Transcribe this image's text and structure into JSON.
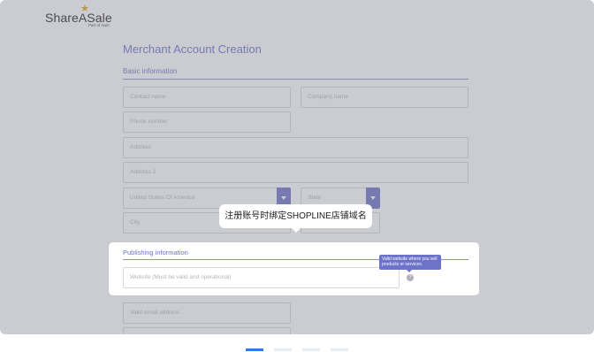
{
  "logo": {
    "name": "ShareASale",
    "tagline": "Part of Awin"
  },
  "title": "Merchant Account Creation",
  "sections": {
    "basic": "Basic information",
    "publishing": "Publishing information"
  },
  "fields": {
    "contact_name": "Contact name",
    "company_name": "Company name",
    "phone_number": "Phone number",
    "address": "Address",
    "address2": "Address 2",
    "country": "United States Of America",
    "state": "State",
    "city": "City",
    "website": "Website (Must be valid and operational)",
    "email": "Valid email address"
  },
  "tooltip": "Valid website where you sell products or services.",
  "help_icon": "?",
  "callout": "注册账号时绑定SHOPLINE店铺域名",
  "pagination": {
    "total": 4,
    "current": 1
  },
  "colors": {
    "accent": "#6d73c8",
    "dot_active": "#3976e4",
    "dot_inactive": "#e3ecf7",
    "star": "#e0a51c"
  }
}
